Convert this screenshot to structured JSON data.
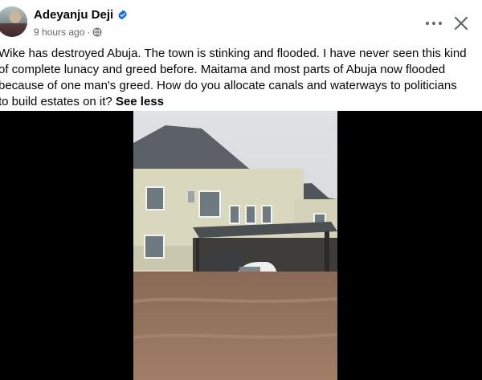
{
  "post": {
    "author": "Adeyanju Deji",
    "time": "9 hours ago",
    "separator": "·",
    "text": "Wike has destroyed Abuja. The town is stinking and flooded. I have never seen this kind of complete lunacy and greed before. Maitama and most parts of Abuja now flooded because of one man's greed. How do you allocate canals and waterways to politicians to build estates on it?",
    "see_more": "See less"
  },
  "icons": {
    "verified": "verified-badge-icon",
    "privacy": "globe-icon",
    "more": "more-options-icon",
    "close": "close-icon"
  },
  "colors": {
    "verified": "#0866ff",
    "meta": "#65676b",
    "text": "#050505"
  }
}
